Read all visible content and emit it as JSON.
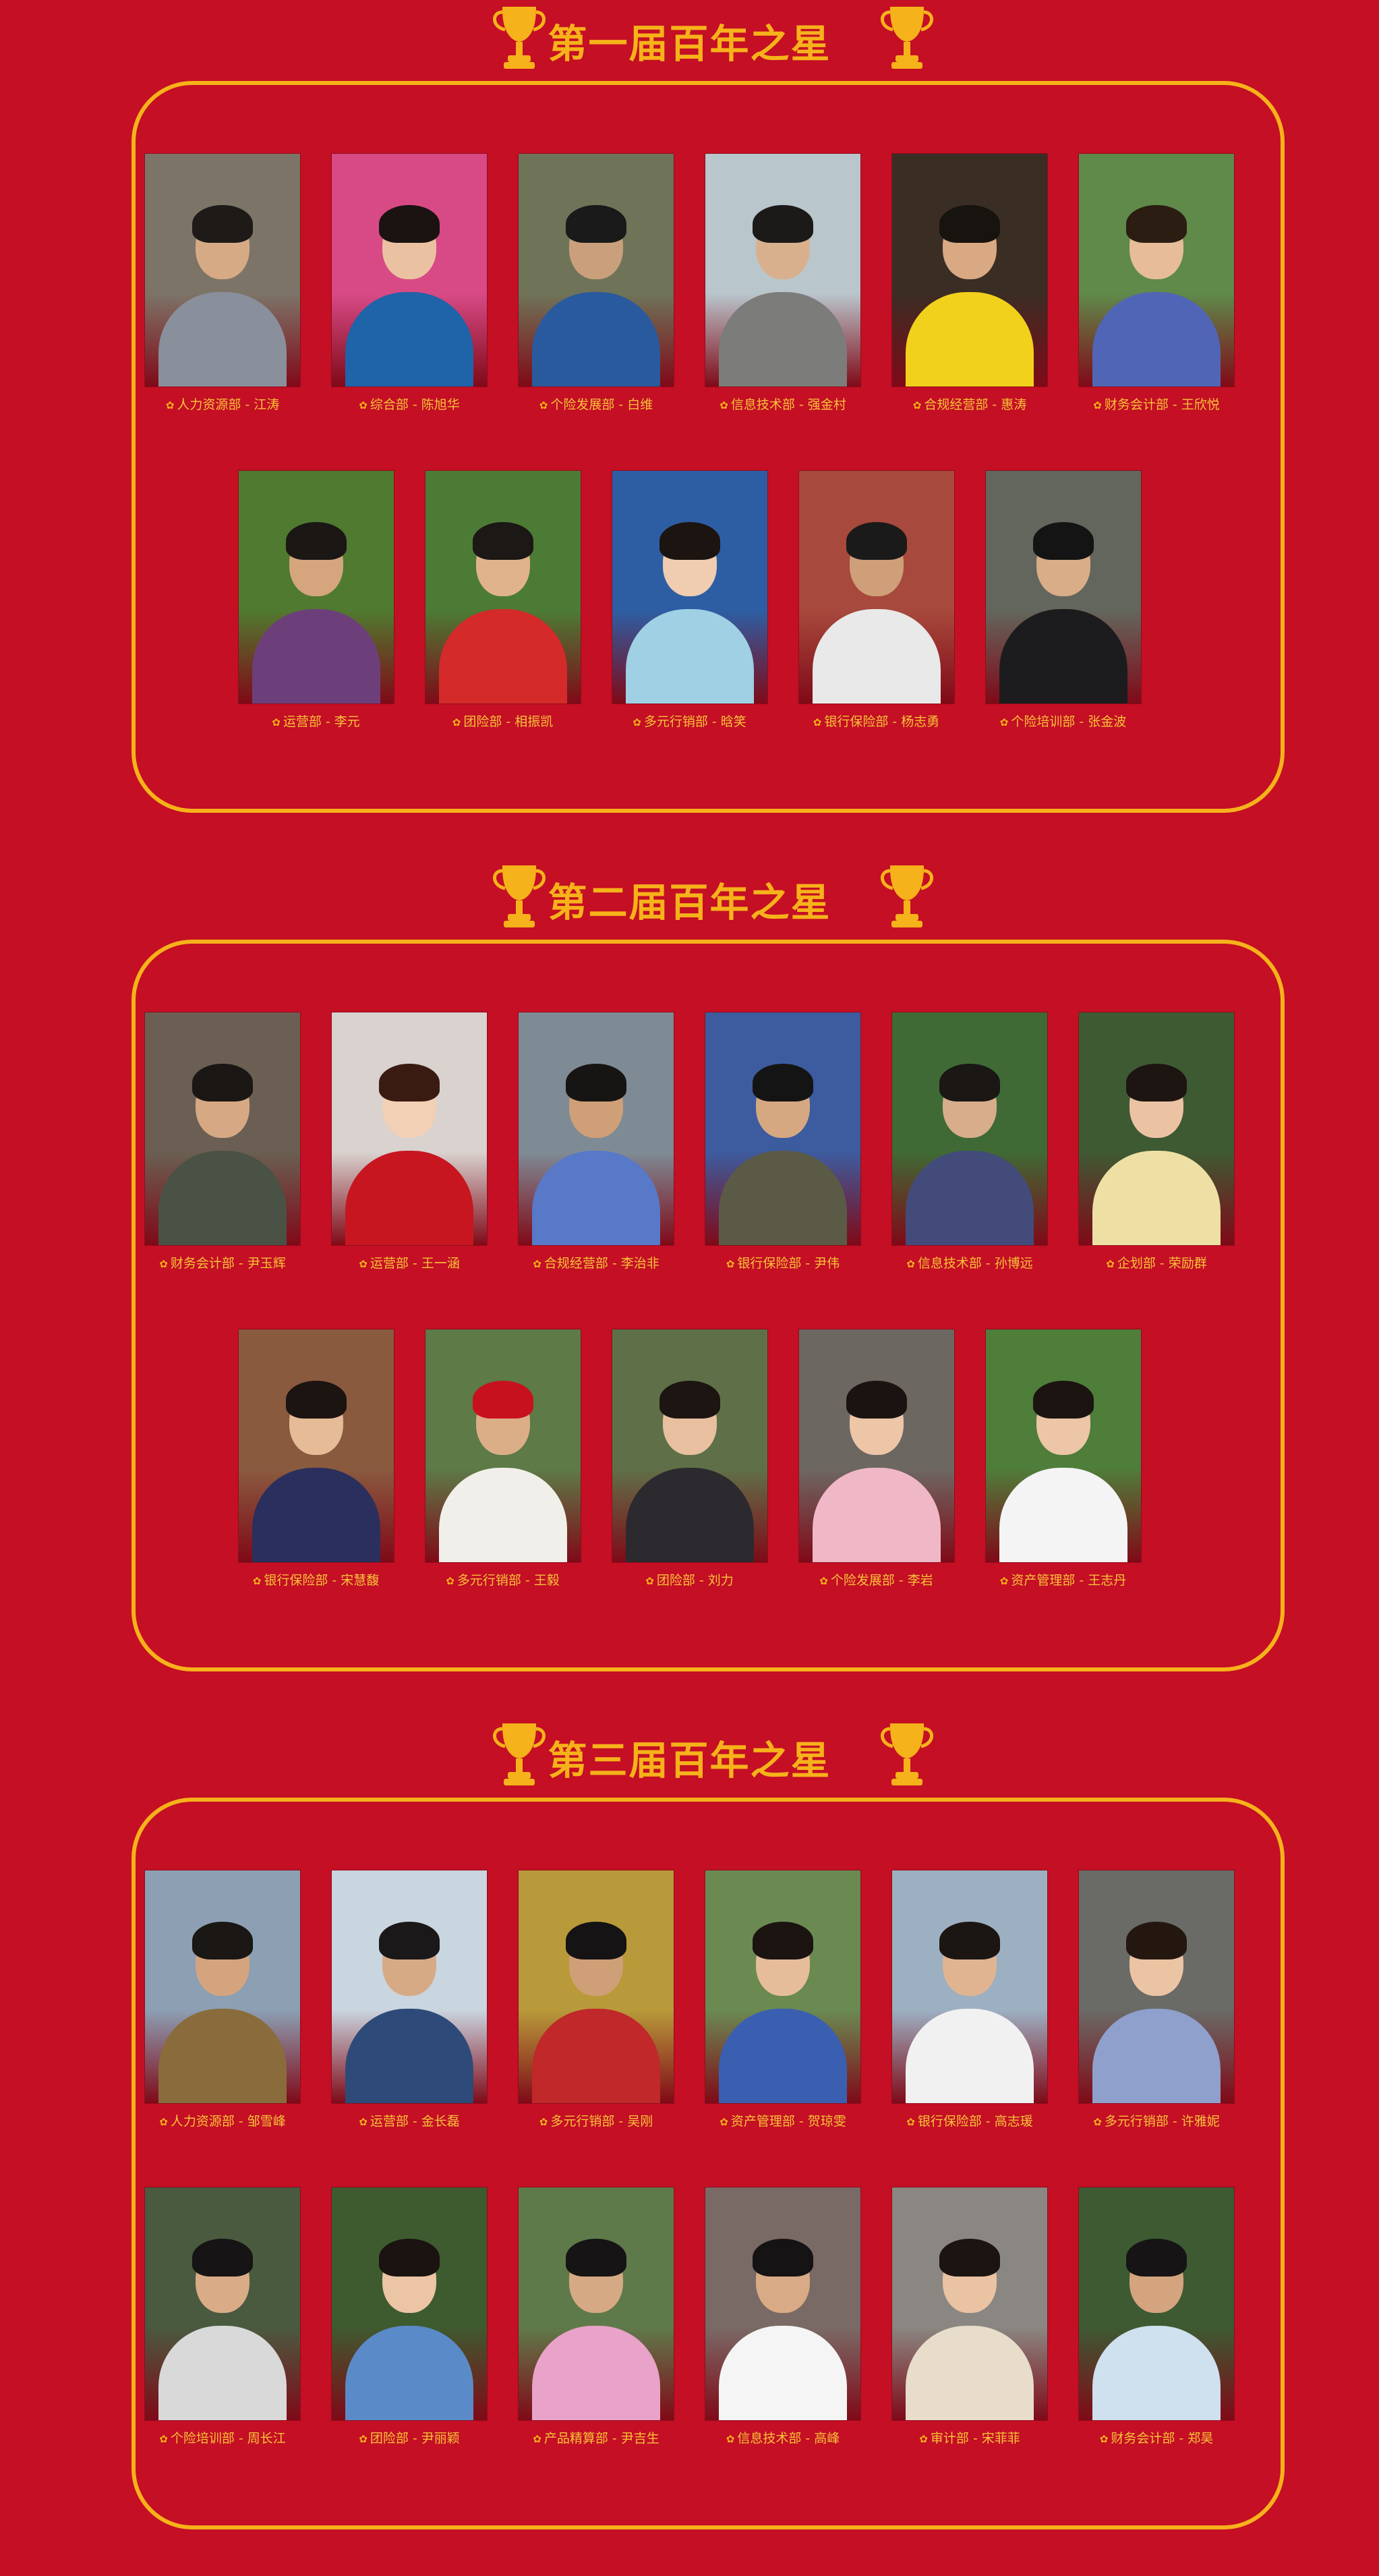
{
  "palette": {
    "background": "#c40f24",
    "gold": "#f6b21a",
    "caption": "#f7c338"
  },
  "sections": [
    {
      "title": "第一届百年之星",
      "rows": [
        [
          {
            "dept": "人力资源部",
            "name": "江涛",
            "label": "人力资源部 - 江涛",
            "bg": "#7d7468",
            "shirt": "#8a8f9c",
            "hair": "#1d1a18",
            "skin": "#d7aa86"
          },
          {
            "dept": "综合部",
            "name": "陈旭华",
            "label": "综合部 - 陈旭华",
            "bg": "#d84a86",
            "shirt": "#1f63a8",
            "hair": "#1b1311",
            "skin": "#ebc2a1"
          },
          {
            "dept": "个险发展部",
            "name": "白维",
            "label": "个险发展部 - 白维",
            "bg": "#6f7458",
            "shirt": "#2a5a9e",
            "hair": "#1a1a1a",
            "skin": "#caa07c"
          },
          {
            "dept": "信息技术部",
            "name": "强金村",
            "label": "信息技术部 - 强金村",
            "bg": "#b9c6cc",
            "shirt": "#7c7c7a",
            "hair": "#1c1a18",
            "skin": "#d9b08d"
          },
          {
            "dept": "合规经营部",
            "name": "惠涛",
            "label": "合规经营部 - 惠涛",
            "bg": "#3a2d24",
            "shirt": "#f2d11c",
            "hair": "#17130f",
            "skin": "#d8a983"
          },
          {
            "dept": "财务会计部",
            "name": "王欣悦",
            "label": "财务会计部 - 王欣悦",
            "bg": "#5f8a4a",
            "shirt": "#5165b6",
            "hair": "#2b1d12",
            "skin": "#e6bd98"
          }
        ],
        [
          {
            "dept": "运营部",
            "name": "李元",
            "label": "运营部 - 李元",
            "bg": "#4f7a2f",
            "shirt": "#6d3f7a",
            "hair": "#1a1715",
            "skin": "#d5a57e"
          },
          {
            "dept": "团险部",
            "name": "相振凯",
            "label": "团险部 - 相振凯",
            "bg": "#4c7b35",
            "shirt": "#d42a2a",
            "hair": "#1b1815",
            "skin": "#e1b38d"
          },
          {
            "dept": "多元行销部",
            "name": "晗笑",
            "label": "多元行销部 - 晗笑",
            "bg": "#2d5ea4",
            "shirt": "#9fd0e4",
            "hair": "#1c1410",
            "skin": "#f0cdb0"
          },
          {
            "dept": "银行保险部",
            "name": "杨志勇",
            "label": "银行保险部 - 杨志勇",
            "bg": "#a7493c",
            "shirt": "#e9e9e9",
            "hair": "#1a1a1a",
            "skin": "#cf9f79"
          },
          {
            "dept": "个险培训部",
            "name": "张金波",
            "label": "个险培训部 - 张金波",
            "bg": "#63665c",
            "shirt": "#1c1c1e",
            "hair": "#141414",
            "skin": "#d8ad88"
          }
        ]
      ]
    },
    {
      "title": "第二届百年之星",
      "rows": [
        [
          {
            "dept": "财务会计部",
            "name": "尹玉辉",
            "label": "财务会计部 - 尹玉辉",
            "bg": "#6a5f52",
            "shirt": "#4a5246",
            "hair": "#1a1715",
            "skin": "#d6a984"
          },
          {
            "dept": "运营部",
            "name": "王一涵",
            "label": "运营部 - 王一涵",
            "bg": "#d9d2cf",
            "shirt": "#c7161f",
            "hair": "#3a1b12",
            "skin": "#f1d0b6"
          },
          {
            "dept": "合规经营部",
            "name": "李治非",
            "label": "合规经营部 - 李治非",
            "bg": "#7e8b95",
            "shirt": "#5878c8",
            "hair": "#171514",
            "skin": "#cf9f78"
          },
          {
            "dept": "银行保险部",
            "name": "尹伟",
            "label": "银行保险部 - 尹伟",
            "bg": "#3d5c9f",
            "shirt": "#5b5a46",
            "hair": "#151414",
            "skin": "#d6a882"
          },
          {
            "dept": "信息技术部",
            "name": "孙博远",
            "label": "信息技术部 - 孙博远",
            "bg": "#3f6a35",
            "shirt": "#434b7a",
            "hair": "#1a1715",
            "skin": "#d8ad8b"
          },
          {
            "dept": "企划部",
            "name": "荣励群",
            "label": "企划部 - 荣励群",
            "bg": "#3e5a33",
            "shirt": "#eee0a4",
            "hair": "#1d1512",
            "skin": "#ebc3a3"
          }
        ],
        [
          {
            "dept": "银行保险部",
            "name": "宋慧馥",
            "label": "银行保险部 - 宋慧馥",
            "bg": "#8a5a3f",
            "shirt": "#2a2f5e",
            "hair": "#1b1411",
            "skin": "#e6bb97"
          },
          {
            "dept": "多元行销部",
            "name": "王毅",
            "label": "多元行销部 - 王毅",
            "bg": "#5d7a47",
            "shirt": "#f1efe9",
            "hair": "#c8111e",
            "skin": "#dcae88"
          },
          {
            "dept": "团险部",
            "name": "刘力",
            "label": "团险部 - 刘力",
            "bg": "#5f7048",
            "shirt": "#2c2a2e",
            "hair": "#1c1512",
            "skin": "#e8c09f"
          },
          {
            "dept": "个险发展部",
            "name": "李岩",
            "label": "个险发展部 - 李岩",
            "bg": "#6d6762",
            "shirt": "#f0b8c6",
            "hair": "#1a1311",
            "skin": "#edc6a8"
          },
          {
            "dept": "资产管理部",
            "name": "王志丹",
            "label": "资产管理部 - 王志丹",
            "bg": "#4f7d3a",
            "shirt": "#f4f4f4",
            "hair": "#1b1411",
            "skin": "#ecc6a7"
          }
        ]
      ]
    },
    {
      "title": "第三届百年之星",
      "rows": [
        [
          {
            "dept": "人力资源部",
            "name": "邹雪峰",
            "label": "人力资源部 - 邹雪峰",
            "bg": "#8c9fb3",
            "shirt": "#8a6c3c",
            "hair": "#1a1715",
            "skin": "#d4a47f"
          },
          {
            "dept": "运营部",
            "name": "金长磊",
            "label": "运营部 - 金长磊",
            "bg": "#c9d5df",
            "shirt": "#2e4a78",
            "hair": "#1a1818",
            "skin": "#d7aa86"
          },
          {
            "dept": "多元行销部",
            "name": "吴刚",
            "label": "多元行销部 - 吴刚",
            "bg": "#b89a3a",
            "shirt": "#c0282a",
            "hair": "#151313",
            "skin": "#cf9f77"
          },
          {
            "dept": "资产管理部",
            "name": "贺琼雯",
            "label": "资产管理部 - 贺琼雯",
            "bg": "#6a8a52",
            "shirt": "#3a5fb0",
            "hair": "#1b1411",
            "skin": "#e6bd9b"
          },
          {
            "dept": "银行保险部",
            "name": "高志瑗",
            "label": "银行保险部 - 高志瑗",
            "bg": "#9cb0c2",
            "shirt": "#f1f1f1",
            "hair": "#1c1612",
            "skin": "#e0b491"
          },
          {
            "dept": "多元行销部",
            "name": "许雅妮",
            "label": "多元行销部 - 许雅妮",
            "bg": "#6a6a66",
            "shirt": "#8fa0cc",
            "hair": "#241710",
            "skin": "#ebc4a4"
          }
        ],
        [
          {
            "dept": "个险培训部",
            "name": "周长江",
            "label": "个险培训部 - 周长江",
            "bg": "#4a5a3f",
            "shirt": "#d9d9d9",
            "hair": "#161414",
            "skin": "#d9ac87"
          },
          {
            "dept": "团险部",
            "name": "尹丽颖",
            "label": "团险部 - 尹丽颖",
            "bg": "#3e5a2f",
            "shirt": "#5b8ac8",
            "hair": "#1a1310",
            "skin": "#ecc5a5"
          },
          {
            "dept": "产品精算部",
            "name": "尹吉生",
            "label": "产品精算部 - 尹吉生",
            "bg": "#5f7a4a",
            "shirt": "#e9a2c8",
            "hair": "#161414",
            "skin": "#d6a985"
          },
          {
            "dept": "信息技术部",
            "name": "高峰",
            "label": "信息技术部 - 高峰",
            "bg": "#7a6a66",
            "shirt": "#f5f5f5",
            "hair": "#151313",
            "skin": "#d8ab86"
          },
          {
            "dept": "审计部",
            "name": "宋菲菲",
            "label": "审计部 - 宋菲菲",
            "bg": "#8a8782",
            "shirt": "#e8dccb",
            "hair": "#1b1411",
            "skin": "#eac3a3"
          },
          {
            "dept": "财务会计部",
            "name": "郑昊",
            "label": "财务会计部 - 郑昊",
            "bg": "#3d5a33",
            "shirt": "#cfe0ee",
            "hair": "#161414",
            "skin": "#d4a47f"
          }
        ]
      ]
    }
  ]
}
